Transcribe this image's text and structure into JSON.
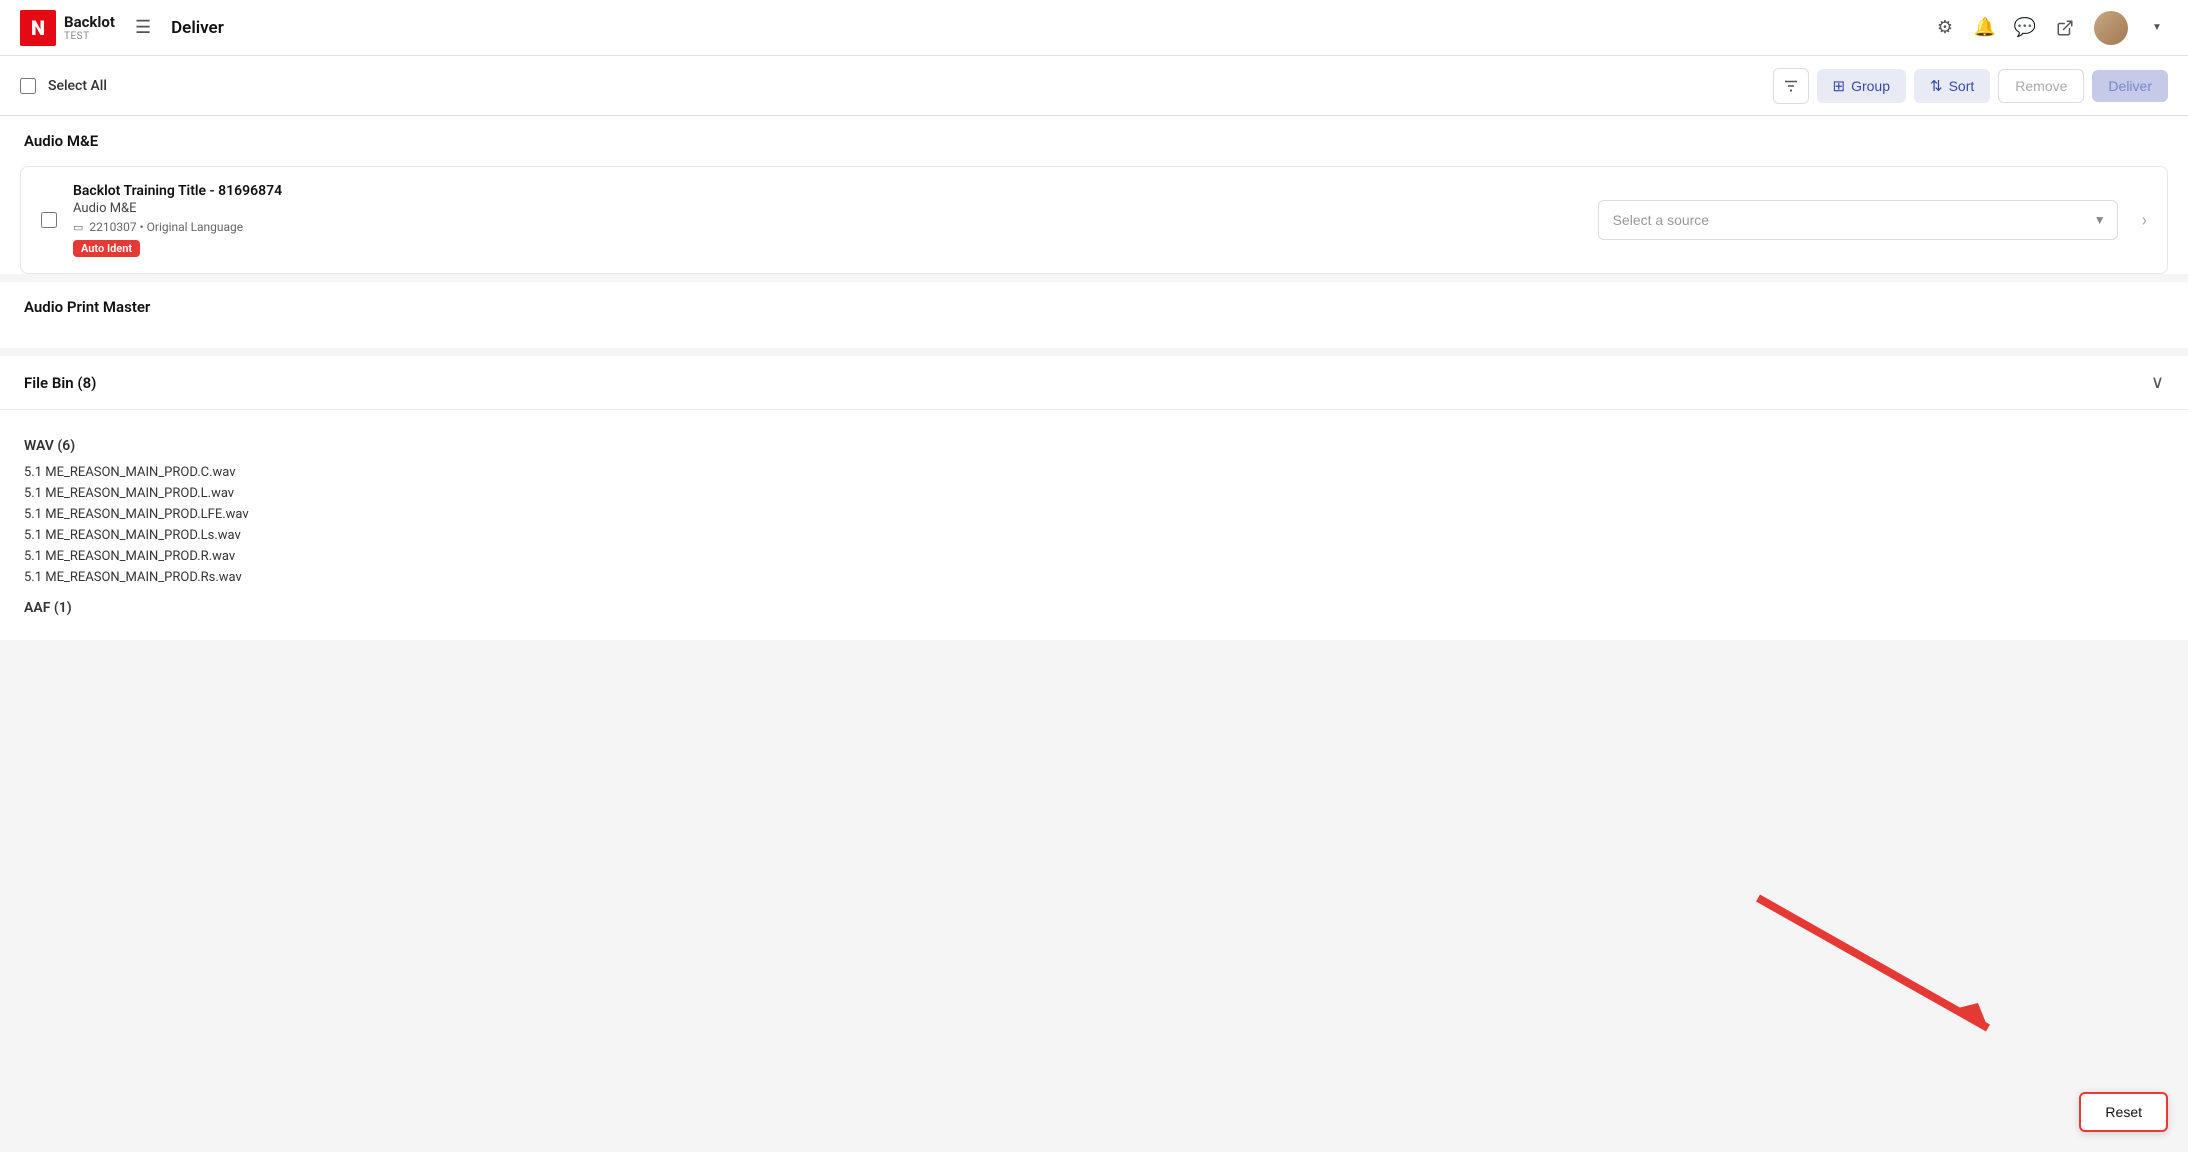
{
  "header": {
    "logo_letter": "N",
    "app_name": "Backlot",
    "app_env": "TEST",
    "page_title": "Deliver",
    "icons": {
      "settings": "⚙",
      "notifications": "🔔",
      "chat": "💬",
      "external": "⬡"
    }
  },
  "toolbar": {
    "select_all_label": "Select All",
    "filter_icon": "≡",
    "group_label": "Group",
    "sort_label": "Sort",
    "remove_label": "Remove",
    "deliver_label": "Deliver"
  },
  "sections": [
    {
      "id": "audio-me",
      "title": "Audio M&E",
      "items": [
        {
          "title": "Backlot Training Title - 81696874",
          "subtitle": "Audio M&E",
          "meta_icon": "▭",
          "meta": "2210307 • Original Language",
          "badge": "Auto Ident",
          "source_placeholder": "Select a source"
        }
      ]
    },
    {
      "id": "audio-print-master",
      "title": "Audio Print Master",
      "items": []
    }
  ],
  "file_bin": {
    "title": "File Bin",
    "count": 8,
    "expanded": true,
    "groups": [
      {
        "label": "WAV (6)",
        "files": [
          "5.1 ME_REASON_MAIN_PROD.C.wav",
          "5.1 ME_REASON_MAIN_PROD.L.wav",
          "5.1 ME_REASON_MAIN_PROD.LFE.wav",
          "5.1 ME_REASON_MAIN_PROD.Ls.wav",
          "5.1 ME_REASON_MAIN_PROD.R.wav",
          "5.1 ME_REASON_MAIN_PROD.Rs.wav"
        ]
      },
      {
        "label": "AAF (1)",
        "files": []
      }
    ]
  },
  "reset_button": {
    "label": "Reset"
  }
}
